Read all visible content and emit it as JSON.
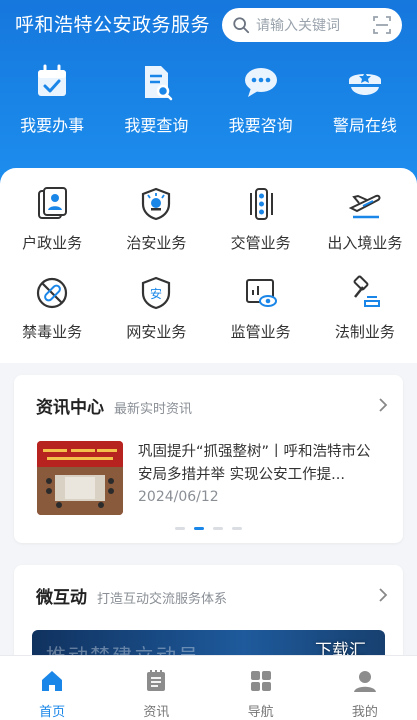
{
  "header": {
    "title": "呼和浩特公安政务服务",
    "search_placeholder": "请输入关键词"
  },
  "quick_actions": [
    {
      "label": "我要办事",
      "icon": "calendar-check-icon"
    },
    {
      "label": "我要查询",
      "icon": "document-search-icon"
    },
    {
      "label": "我要咨询",
      "icon": "chat-bubble-icon"
    },
    {
      "label": "警局在线",
      "icon": "police-cap-icon"
    }
  ],
  "services": [
    {
      "label": "户政业务",
      "icon": "id-card-icon"
    },
    {
      "label": "治安业务",
      "icon": "shield-icon"
    },
    {
      "label": "交管业务",
      "icon": "traffic-light-icon"
    },
    {
      "label": "出入境业务",
      "icon": "airplane-icon"
    },
    {
      "label": "禁毒业务",
      "icon": "no-drugs-icon"
    },
    {
      "label": "网安业务",
      "icon": "network-shield-icon"
    },
    {
      "label": "监管业务",
      "icon": "monitor-eye-icon"
    },
    {
      "label": "法制业务",
      "icon": "gavel-icon"
    }
  ],
  "news": {
    "title": "资讯中心",
    "subtitle": "最新实时资讯",
    "item_title": "巩固提升“抓强整树”丨呼和浩特市公安局多措并举 实现公安工作提...",
    "item_date": "2024/06/12",
    "carousel_pages": 4,
    "carousel_active": 1
  },
  "micro": {
    "title": "微互动",
    "subtitle": "打造互动交流服务体系",
    "banner_text": "推动楚建立动员"
  },
  "watermark": "下载汇",
  "tabbar": [
    {
      "label": "首页",
      "icon": "home-icon",
      "active": true
    },
    {
      "label": "资讯",
      "icon": "newspaper-icon",
      "active": false
    },
    {
      "label": "导航",
      "icon": "grid-icon",
      "active": false
    },
    {
      "label": "我的",
      "icon": "user-icon",
      "active": false
    }
  ],
  "colors": {
    "primary": "#1a86e8",
    "header": "#1677dd",
    "background": "#f3f5f8"
  }
}
